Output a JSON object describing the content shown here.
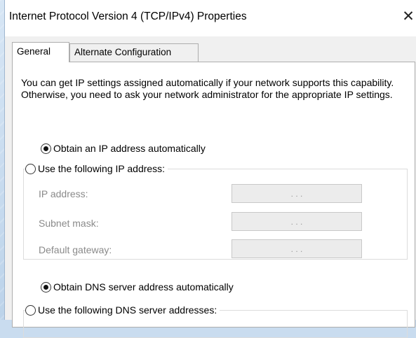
{
  "window": {
    "title": "Internet Protocol Version 4 (TCP/IPv4) Properties",
    "close_glyph": "✕"
  },
  "tabs": [
    {
      "label": "General",
      "selected": true
    },
    {
      "label": "Alternate Configuration",
      "selected": false
    }
  ],
  "general": {
    "description": "You can get IP settings assigned automatically if your network supports this capability. Otherwise, you need to ask your network administrator for the appropriate IP settings.",
    "ip_mode": {
      "auto_label": "Obtain an IP address automatically",
      "manual_label": "Use the following IP address:",
      "selected": "auto"
    },
    "ip_fields": [
      {
        "label": "IP address:",
        "value": ". . ."
      },
      {
        "label": "Subnet mask:",
        "value": ". . ."
      },
      {
        "label": "Default gateway:",
        "value": ". . ."
      }
    ],
    "dns_mode": {
      "auto_label": "Obtain DNS server address automatically",
      "manual_label": "Use the following DNS server addresses:",
      "selected": "auto"
    }
  },
  "colors": {
    "dialog_bg": "#f0f0f0",
    "panel_bg": "#ffffff",
    "disabled_text": "#8a8a8a",
    "disabled_field": "#ececec"
  }
}
